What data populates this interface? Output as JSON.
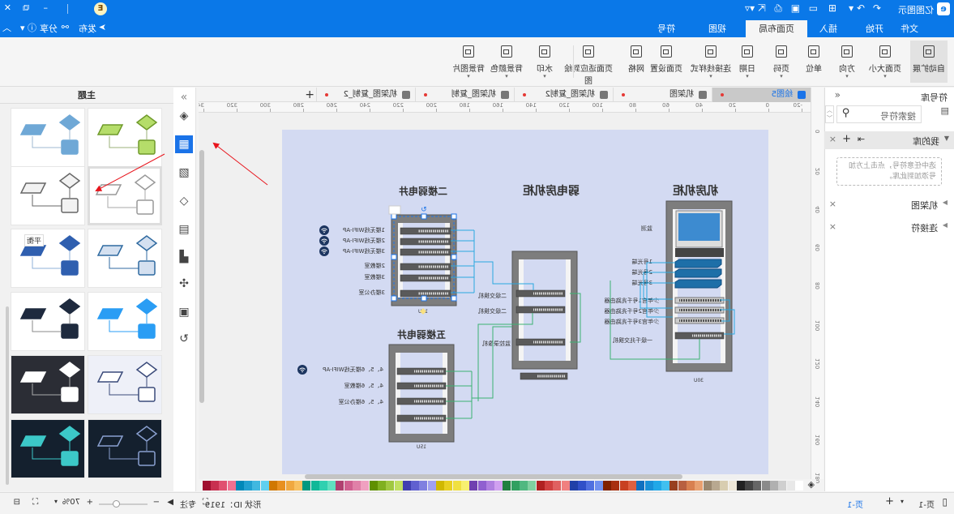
{
  "app": {
    "title": "亿图图示"
  },
  "titlebar": {
    "icons": [
      "logo-icon",
      "undo-icon",
      "redo-icon",
      "new-icon",
      "open-icon",
      "save-icon",
      "print-icon",
      "export-icon",
      "more-icon"
    ],
    "badge": "E"
  },
  "menu": {
    "tabs": [
      "文件",
      "开始",
      "插入",
      "页面布局",
      "视图",
      "符号"
    ],
    "active": "页面布局",
    "publish": "发布",
    "share": "分享"
  },
  "ribbon": {
    "buttons": [
      {
        "label": "自动扩展",
        "dropdown": false,
        "active": true
      },
      {
        "label": "页面大小",
        "dropdown": true
      },
      {
        "label": "方向",
        "dropdown": true
      },
      {
        "label": "单位",
        "dropdown": false
      },
      {
        "label": "页码",
        "dropdown": true
      },
      {
        "label": "日期",
        "dropdown": true
      },
      {
        "label": "连接线样式",
        "dropdown": true
      },
      {
        "label": "页面设置",
        "dropdown": false
      },
      {
        "label": "网格",
        "dropdown": false
      },
      {
        "label": "页面适应到绘图",
        "dropdown": false
      },
      {
        "label": "水印",
        "dropdown": true
      },
      {
        "label": "背景颜色",
        "dropdown": true
      },
      {
        "label": "背景图片",
        "dropdown": true
      }
    ]
  },
  "symbols": {
    "title": "符号库",
    "search_placeholder": "搜索符号",
    "my_library": "我的库",
    "hint": "选中任意符号，点击上方加号添加到此库。",
    "libraries": [
      "机架图",
      "连接符"
    ]
  },
  "doc_tabs": [
    {
      "label": "绘图5",
      "active": true
    },
    {
      "label": "机架图"
    },
    {
      "label": "机架图_复制2"
    },
    {
      "label": "机架图_复制"
    },
    {
      "label": "机架图_复制_2"
    }
  ],
  "ruler": {
    "h": [
      "-20",
      "0",
      "20",
      "40",
      "60",
      "80",
      "100",
      "120",
      "140",
      "160",
      "180",
      "200",
      "220",
      "240",
      "260",
      "280",
      "300",
      "320",
      "340"
    ],
    "v": [
      "0",
      "20",
      "40",
      "60",
      "80",
      "100",
      "120",
      "140",
      "160",
      "180"
    ]
  },
  "diagram": {
    "racks": [
      {
        "title": "机房机柜",
        "units": "30U",
        "labels": [
          "监测",
          "1号光端",
          "2号光端",
          "3号光端",
          "少年宫1号千兆路由器",
          "少年宫2号千兆路由器",
          "少年宫3号千兆路由器",
          "一级千兆交换机"
        ]
      },
      {
        "title": "弱电房机柜",
        "labels": [
          "二级交换机",
          "二级交换机",
          "监控录像机"
        ]
      },
      {
        "title": "二楼弱电井",
        "units": "10U",
        "labels": [
          "1楼无线WIFI-AP",
          "2楼无线WIFI-AP",
          "3楼无线WIFI-AP",
          "2楼教室",
          "3楼教室",
          "3楼办公室"
        ]
      },
      {
        "title": "五楼弱电井",
        "units": "15U",
        "labels": [
          "4、5、6楼无线WIFI-AP",
          "4、5、6楼教室",
          "4、5、6楼办公室"
        ]
      }
    ],
    "colors": {
      "page": "#d3daf2",
      "blue_link": "#29a8e0",
      "green_link": "#3bb273",
      "rack": "#8a8a8a"
    }
  },
  "themes": {
    "title": "主题",
    "tooltip": "平衡",
    "items": [
      {
        "name": "green",
        "fill": "#b5dd6a",
        "stroke": "#6f9a2a",
        "line": "#9bb07a",
        "bg": "#ffffff"
      },
      {
        "name": "blue",
        "fill": "#6fa8d6",
        "stroke": "#6fa8d6",
        "line": "#9fb8d0",
        "bg": "#ffffff"
      },
      {
        "name": "white",
        "fill": "#ffffff",
        "stroke": "#999999",
        "line": "#aaaaaa",
        "bg": "#ffffff",
        "selected": true
      },
      {
        "name": "gray",
        "fill": "#f2f2f2",
        "stroke": "#666666",
        "line": "#666666",
        "bg": "#ffffff"
      },
      {
        "name": "light-blue",
        "fill": "#d4e0f0",
        "stroke": "#2f6aa0",
        "line": "#2f6aa0",
        "bg": "#ffffff"
      },
      {
        "name": "balance",
        "fill": "#2f5faf",
        "stroke": "#2f5faf",
        "line": "#8fb0d8",
        "bg": "#ffffff"
      },
      {
        "name": "bright-blue",
        "fill": "#2a9df4",
        "stroke": "#2a9df4",
        "line": "#2a9df4",
        "bg": "#ffffff"
      },
      {
        "name": "navy",
        "fill": "#1e2a3e",
        "stroke": "#1e2a3e",
        "line": "#888888",
        "bg": "#ffffff"
      },
      {
        "name": "outline-light",
        "fill": "#ffffff",
        "stroke": "#3a4a7a",
        "line": "#3a4a7a",
        "bg": "#eef0f8"
      },
      {
        "name": "dark",
        "fill": "#ffffff",
        "stroke": "#ffffff",
        "line": "#aaaaaa",
        "bg": "#2b2d35"
      },
      {
        "name": "dark-outline",
        "fill": "#14202e",
        "stroke": "#8aa0d0",
        "line": "#8aa0d0",
        "bg": "#14202e"
      },
      {
        "name": "dark-teal",
        "fill": "#3cc8c8",
        "stroke": "#3cc8c8",
        "line": "#3cc8c8",
        "bg": "#14202e"
      }
    ]
  },
  "palette": [
    "#ffffff",
    "#e8e8e8",
    "#cfcfcf",
    "#b0b0b0",
    "#8a8a8a",
    "#666666",
    "#444444",
    "#222222",
    "#efe8d8",
    "#d8cdb0",
    "#b8a890",
    "#9a8870",
    "#e8a070",
    "#d88050",
    "#b86040",
    "#984020",
    "#40c0f0",
    "#20a8e8",
    "#1890d8",
    "#1070c0",
    "#e06040",
    "#c84020",
    "#a83010",
    "#802000",
    "#7090f0",
    "#5070e0",
    "#3050c8",
    "#2040a8",
    "#f08080",
    "#e06060",
    "#d04040",
    "#b02020",
    "#80d0a0",
    "#50b880",
    "#30a060",
    "#208040",
    "#d0a0f0",
    "#b080e0",
    "#9060d0",
    "#7040b0",
    "#f8f070",
    "#f0e040",
    "#e8d020",
    "#d0b800",
    "#a0a0f0",
    "#8080e0",
    "#6060d0",
    "#4040b0",
    "#c0e060",
    "#a0c840",
    "#80b020",
    "#609000",
    "#f0a0c0",
    "#e080a8",
    "#d06090",
    "#b04070",
    "#60e0c0",
    "#30d0b0",
    "#10b898",
    "#009880",
    "#f8c060",
    "#f0a840",
    "#e89020",
    "#d07800",
    "#60d0f0",
    "#40b8e0",
    "#20a0d0",
    "#0088b8",
    "#f07090",
    "#e05070",
    "#c83050",
    "#a01030"
  ],
  "status": {
    "page_label": "页-1",
    "page_tab": "页-1",
    "shape_id": "形状 ID：1919",
    "focus": "专注",
    "zoom": "70%",
    "zoom_level": 0.7
  }
}
